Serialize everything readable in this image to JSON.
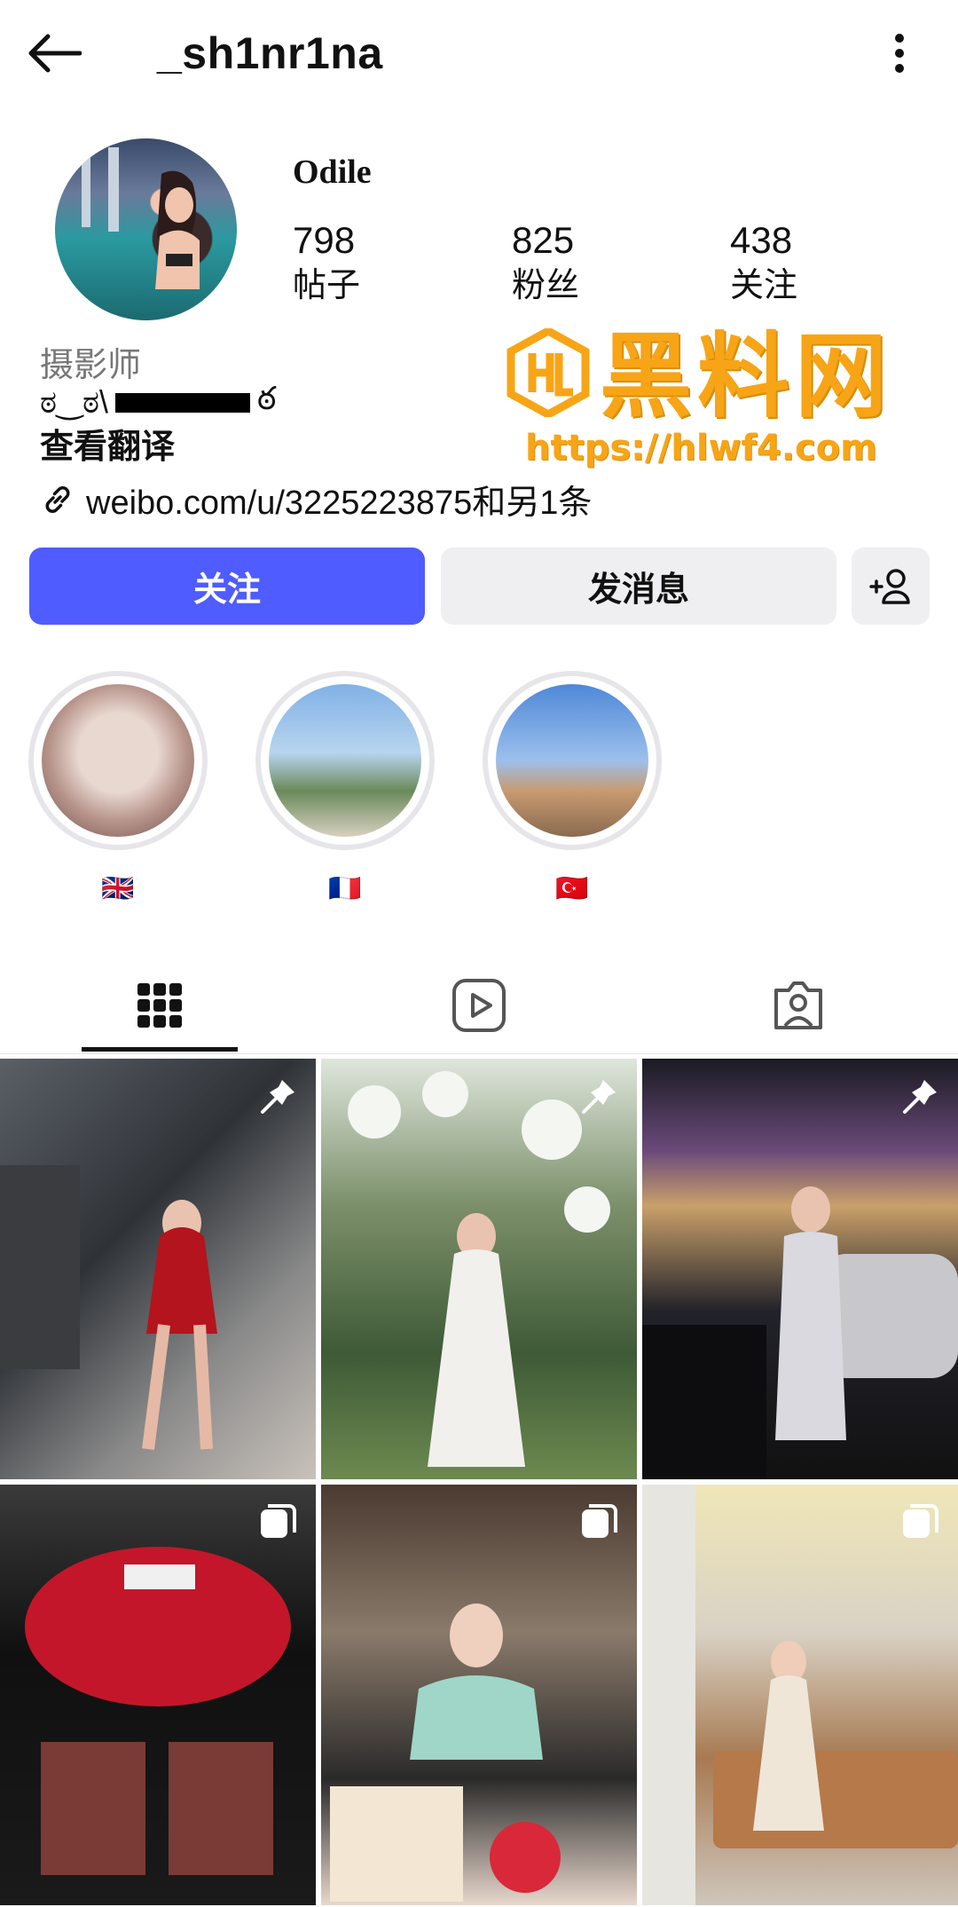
{
  "header": {
    "username": "_sh1nr1na"
  },
  "profile": {
    "display_name": "Odile",
    "stats": [
      {
        "value": "798",
        "label": "帖子"
      },
      {
        "value": "825",
        "label": "粉丝"
      },
      {
        "value": "438",
        "label": "关注"
      }
    ],
    "bio_title": "摄影师",
    "bio_line_prefix": "ಠ‿ಠ\\",
    "bio_line_suffix": "ఠ",
    "translate": "查看翻译",
    "link": "weibo.com/u/3225223875和另1条"
  },
  "watermark": {
    "title": "黑料网",
    "url": "https://hlwf4.com"
  },
  "actions": {
    "follow": "关注",
    "message": "发消息"
  },
  "highlights": [
    {
      "flag": "🇬🇧"
    },
    {
      "flag": "🇫🇷"
    },
    {
      "flag": "🇹🇷"
    }
  ],
  "colors": {
    "accent": "#4f5cff",
    "button_gray": "#efeff1",
    "watermark": "#f7a516"
  },
  "posts": [
    {
      "badge": "pin-icon"
    },
    {
      "badge": "pin-icon"
    },
    {
      "badge": "pin-icon"
    },
    {
      "badge": "carousel-icon"
    },
    {
      "badge": "carousel-icon"
    },
    {
      "badge": "carousel-icon"
    }
  ]
}
